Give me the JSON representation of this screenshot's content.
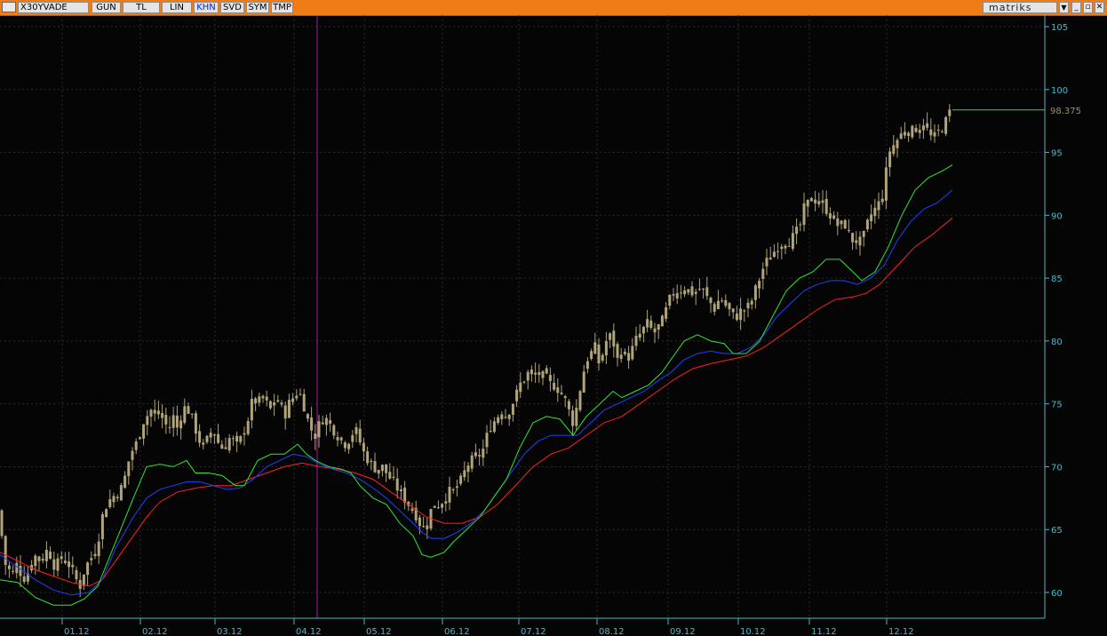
{
  "toolbar": {
    "symbol": "X30YVADE",
    "buttons": [
      "GUN",
      "TL",
      "LIN",
      "KHN",
      "SVD",
      "SYM",
      "TMP"
    ],
    "active_button": "KHN",
    "brand": "matriks",
    "window_controls": [
      "minimize-icon",
      "restore-icon",
      "close-icon"
    ]
  },
  "colors": {
    "background": "#050505",
    "toolbar": "#f07c18",
    "axis_text": "#4cb8c8",
    "candle": "#b0a478",
    "ma_fast": "#2ee82e",
    "ma_mid": "#2040ff",
    "ma_slow": "#ff2020",
    "crosshair": "#a020a0",
    "last_price_line": "#40d040"
  },
  "chart_data": {
    "type": "candlestick",
    "x_ticks": [
      "01.12",
      "02.12",
      "03.12",
      "04.12",
      "05.12",
      "06.12",
      "07.12",
      "08.12",
      "09.12",
      "10.12",
      "11.12",
      "12.12"
    ],
    "y_ticks": [
      60,
      65,
      70,
      75,
      80,
      85,
      90,
      95,
      100,
      105
    ],
    "ylim": [
      57.5,
      106.5
    ],
    "last_price": "98.375",
    "close_points": [
      [
        0,
        66.5
      ],
      [
        4,
        62.5
      ],
      [
        10,
        61.8
      ],
      [
        16,
        61.5
      ],
      [
        20,
        62.5
      ],
      [
        25,
        61.0
      ],
      [
        31,
        61.5
      ],
      [
        38,
        63.0
      ],
      [
        46,
        62.5
      ],
      [
        54,
        63.5
      ],
      [
        62,
        62.0
      ],
      [
        70,
        62.8
      ],
      [
        78,
        62.2
      ],
      [
        86,
        61.0
      ],
      [
        90,
        60.5
      ],
      [
        95,
        61.8
      ],
      [
        100,
        62.5
      ],
      [
        105,
        63.0
      ],
      [
        110,
        64.0
      ],
      [
        115,
        66.0
      ],
      [
        120,
        67.0
      ],
      [
        125,
        67.5
      ],
      [
        130,
        67.8
      ],
      [
        135,
        68.0
      ],
      [
        140,
        69.0
      ],
      [
        145,
        70.5
      ],
      [
        150,
        71.5
      ],
      [
        155,
        72.0
      ],
      [
        160,
        73.5
      ],
      [
        165,
        74.0
      ],
      [
        170,
        74.5
      ],
      [
        175,
        74.0
      ],
      [
        180,
        74.3
      ],
      [
        185,
        73.5
      ],
      [
        190,
        73.0
      ],
      [
        195,
        74.0
      ],
      [
        200,
        73.0
      ],
      [
        205,
        74.5
      ],
      [
        210,
        74.8
      ],
      [
        215,
        74.0
      ],
      [
        220,
        73.0
      ],
      [
        225,
        72.0
      ],
      [
        230,
        71.5
      ],
      [
        235,
        72.5
      ],
      [
        240,
        73.0
      ],
      [
        245,
        72.0
      ],
      [
        250,
        71.5
      ],
      [
        255,
        71.8
      ],
      [
        260,
        72.5
      ],
      [
        265,
        71.5
      ],
      [
        270,
        72.0
      ],
      [
        275,
        73.0
      ],
      [
        280,
        74.0
      ],
      [
        285,
        75.5
      ],
      [
        290,
        75.0
      ],
      [
        295,
        75.5
      ],
      [
        300,
        75.0
      ],
      [
        305,
        74.5
      ],
      [
        310,
        75.5
      ],
      [
        315,
        75.0
      ],
      [
        320,
        74.0
      ],
      [
        325,
        75.0
      ],
      [
        330,
        75.5
      ],
      [
        335,
        76.0
      ],
      [
        340,
        75.5
      ],
      [
        345,
        74.0
      ],
      [
        350,
        73.0
      ],
      [
        355,
        72.5
      ],
      [
        360,
        73.5
      ],
      [
        365,
        74.0
      ],
      [
        370,
        73.5
      ],
      [
        375,
        73.0
      ],
      [
        380,
        72.5
      ],
      [
        385,
        72.0
      ],
      [
        390,
        71.8
      ],
      [
        395,
        72.5
      ],
      [
        400,
        73.0
      ],
      [
        405,
        72.0
      ],
      [
        410,
        71.0
      ],
      [
        415,
        70.5
      ],
      [
        420,
        70.0
      ],
      [
        425,
        69.8
      ],
      [
        430,
        70.0
      ],
      [
        435,
        69.5
      ],
      [
        440,
        69.0
      ],
      [
        445,
        68.5
      ],
      [
        450,
        68.0
      ],
      [
        455,
        67.5
      ],
      [
        460,
        67.0
      ],
      [
        465,
        66.5
      ],
      [
        470,
        66.0
      ],
      [
        475,
        65.0
      ],
      [
        480,
        65.5
      ],
      [
        485,
        66.5
      ],
      [
        490,
        67.0
      ],
      [
        495,
        67.0
      ],
      [
        500,
        67.5
      ],
      [
        505,
        68.0
      ],
      [
        510,
        68.0
      ],
      [
        515,
        68.5
      ],
      [
        520,
        69.0
      ],
      [
        525,
        70.0
      ],
      [
        530,
        70.5
      ],
      [
        535,
        70.5
      ],
      [
        540,
        71.0
      ],
      [
        545,
        71.5
      ],
      [
        550,
        73.0
      ],
      [
        555,
        73.5
      ],
      [
        560,
        74.0
      ],
      [
        565,
        74.5
      ],
      [
        570,
        74.0
      ],
      [
        575,
        74.8
      ],
      [
        580,
        75.5
      ],
      [
        585,
        76.5
      ],
      [
        590,
        77.0
      ],
      [
        595,
        77.5
      ],
      [
        600,
        77.0
      ],
      [
        605,
        77.5
      ],
      [
        610,
        77.2
      ],
      [
        615,
        77.0
      ],
      [
        620,
        76.5
      ],
      [
        625,
        76.5
      ],
      [
        630,
        76.0
      ],
      [
        635,
        75.5
      ],
      [
        640,
        74.5
      ],
      [
        645,
        73.5
      ],
      [
        650,
        75.0
      ],
      [
        655,
        77.0
      ],
      [
        660,
        78.5
      ],
      [
        665,
        79.0
      ],
      [
        670,
        79.5
      ],
      [
        675,
        78.0
      ],
      [
        680,
        79.5
      ],
      [
        685,
        80.5
      ],
      [
        690,
        80.0
      ],
      [
        695,
        78.5
      ],
      [
        700,
        79.5
      ],
      [
        705,
        78.5
      ],
      [
        710,
        79.0
      ],
      [
        715,
        80.0
      ],
      [
        720,
        80.5
      ],
      [
        725,
        81.0
      ],
      [
        730,
        81.5
      ],
      [
        735,
        80.5
      ],
      [
        740,
        81.0
      ],
      [
        745,
        81.5
      ],
      [
        750,
        82.5
      ],
      [
        755,
        83.5
      ],
      [
        760,
        84.0
      ],
      [
        765,
        84.0
      ],
      [
        770,
        84.3
      ],
      [
        775,
        84.0
      ],
      [
        780,
        83.8
      ],
      [
        785,
        84.0
      ],
      [
        790,
        84.2
      ],
      [
        795,
        83.5
      ],
      [
        800,
        83.0
      ],
      [
        805,
        82.5
      ],
      [
        810,
        83.5
      ],
      [
        815,
        83.0
      ],
      [
        820,
        82.5
      ],
      [
        825,
        82.0
      ],
      [
        830,
        82.0
      ],
      [
        835,
        82.5
      ],
      [
        840,
        82.5
      ],
      [
        845,
        83.0
      ],
      [
        850,
        84.0
      ],
      [
        855,
        85.0
      ],
      [
        860,
        86.0
      ],
      [
        865,
        86.5
      ],
      [
        870,
        87.0
      ],
      [
        875,
        87.5
      ],
      [
        880,
        87.8
      ],
      [
        885,
        88.0
      ],
      [
        890,
        88.0
      ],
      [
        895,
        88.5
      ],
      [
        900,
        89.0
      ],
      [
        905,
        90.5
      ],
      [
        910,
        91.0
      ],
      [
        915,
        91.5
      ],
      [
        920,
        91.0
      ],
      [
        925,
        91.0
      ],
      [
        930,
        90.5
      ],
      [
        935,
        90.0
      ],
      [
        940,
        89.5
      ],
      [
        945,
        89.0
      ],
      [
        950,
        89.5
      ],
      [
        955,
        88.5
      ],
      [
        960,
        88.0
      ],
      [
        965,
        88.0
      ],
      [
        970,
        87.8
      ],
      [
        975,
        89.0
      ],
      [
        980,
        90.0
      ],
      [
        985,
        90.5
      ],
      [
        990,
        91.0
      ],
      [
        995,
        92.0
      ],
      [
        1000,
        95.0
      ],
      [
        1005,
        95.5
      ],
      [
        1010,
        96.0
      ],
      [
        1015,
        96.5
      ],
      [
        1020,
        97.0
      ],
      [
        1025,
        96.5
      ],
      [
        1030,
        97.0
      ],
      [
        1035,
        96.8
      ],
      [
        1040,
        97.5
      ],
      [
        1045,
        96.5
      ],
      [
        1050,
        96.0
      ],
      [
        1055,
        96.5
      ],
      [
        1060,
        97.0
      ],
      [
        1065,
        97.5
      ],
      [
        1070,
        98.375
      ]
    ],
    "ma_fast": [
      [
        0,
        61.0
      ],
      [
        20,
        60.8
      ],
      [
        40,
        59.6
      ],
      [
        60,
        59.0
      ],
      [
        80,
        59.0
      ],
      [
        95,
        59.5
      ],
      [
        110,
        60.5
      ],
      [
        130,
        64.0
      ],
      [
        150,
        67.5
      ],
      [
        165,
        70.0
      ],
      [
        180,
        70.2
      ],
      [
        195,
        70.0
      ],
      [
        210,
        70.5
      ],
      [
        220,
        69.5
      ],
      [
        235,
        69.5
      ],
      [
        250,
        69.3
      ],
      [
        265,
        68.5
      ],
      [
        275,
        68.5
      ],
      [
        290,
        70.5
      ],
      [
        305,
        71.0
      ],
      [
        320,
        71.0
      ],
      [
        335,
        71.8
      ],
      [
        345,
        71.0
      ],
      [
        355,
        70.5
      ],
      [
        370,
        70.0
      ],
      [
        385,
        69.8
      ],
      [
        395,
        69.5
      ],
      [
        405,
        68.5
      ],
      [
        420,
        67.5
      ],
      [
        435,
        67.0
      ],
      [
        450,
        65.5
      ],
      [
        465,
        64.5
      ],
      [
        475,
        63.0
      ],
      [
        485,
        62.8
      ],
      [
        500,
        63.2
      ],
      [
        510,
        64.0
      ],
      [
        525,
        65.0
      ],
      [
        540,
        66.0
      ],
      [
        555,
        67.5
      ],
      [
        570,
        69.0
      ],
      [
        585,
        71.5
      ],
      [
        600,
        73.5
      ],
      [
        615,
        74.0
      ],
      [
        630,
        73.8
      ],
      [
        645,
        72.5
      ],
      [
        660,
        74.0
      ],
      [
        675,
        75.0
      ],
      [
        690,
        76.0
      ],
      [
        700,
        75.5
      ],
      [
        715,
        76.0
      ],
      [
        730,
        76.5
      ],
      [
        745,
        77.5
      ],
      [
        760,
        79.0
      ],
      [
        770,
        80.0
      ],
      [
        785,
        80.5
      ],
      [
        800,
        80.0
      ],
      [
        815,
        79.8
      ],
      [
        825,
        79.0
      ],
      [
        840,
        79.0
      ],
      [
        855,
        80.0
      ],
      [
        870,
        82.0
      ],
      [
        885,
        84.0
      ],
      [
        900,
        85.0
      ],
      [
        915,
        85.5
      ],
      [
        930,
        86.5
      ],
      [
        945,
        86.5
      ],
      [
        960,
        85.5
      ],
      [
        970,
        84.8
      ],
      [
        985,
        85.5
      ],
      [
        1000,
        87.5
      ],
      [
        1015,
        90.0
      ],
      [
        1030,
        92.0
      ],
      [
        1045,
        93.0
      ],
      [
        1060,
        93.5
      ],
      [
        1072,
        94.0
      ]
    ],
    "ma_mid": [
      [
        0,
        63.0
      ],
      [
        20,
        62.0
      ],
      [
        40,
        61.0
      ],
      [
        60,
        60.2
      ],
      [
        80,
        59.8
      ],
      [
        100,
        60.0
      ],
      [
        115,
        61.0
      ],
      [
        130,
        63.5
      ],
      [
        150,
        66.0
      ],
      [
        165,
        67.5
      ],
      [
        180,
        68.2
      ],
      [
        195,
        68.5
      ],
      [
        210,
        68.8
      ],
      [
        225,
        68.8
      ],
      [
        240,
        68.5
      ],
      [
        255,
        68.2
      ],
      [
        270,
        68.3
      ],
      [
        285,
        69.0
      ],
      [
        300,
        70.0
      ],
      [
        315,
        70.5
      ],
      [
        330,
        71.0
      ],
      [
        345,
        70.8
      ],
      [
        360,
        70.2
      ],
      [
        375,
        69.8
      ],
      [
        390,
        69.5
      ],
      [
        405,
        69.0
      ],
      [
        420,
        68.3
      ],
      [
        435,
        67.5
      ],
      [
        450,
        66.5
      ],
      [
        465,
        65.5
      ],
      [
        475,
        64.8
      ],
      [
        485,
        64.3
      ],
      [
        500,
        64.3
      ],
      [
        515,
        64.8
      ],
      [
        530,
        65.5
      ],
      [
        545,
        66.5
      ],
      [
        560,
        68.0
      ],
      [
        575,
        69.5
      ],
      [
        590,
        71.0
      ],
      [
        605,
        72.0
      ],
      [
        620,
        72.5
      ],
      [
        635,
        72.5
      ],
      [
        650,
        72.5
      ],
      [
        665,
        73.5
      ],
      [
        680,
        74.5
      ],
      [
        695,
        75.0
      ],
      [
        710,
        75.5
      ],
      [
        725,
        76.0
      ],
      [
        740,
        76.8
      ],
      [
        755,
        77.5
      ],
      [
        770,
        78.5
      ],
      [
        785,
        79.0
      ],
      [
        800,
        79.2
      ],
      [
        815,
        79.0
      ],
      [
        830,
        79.0
      ],
      [
        845,
        79.5
      ],
      [
        860,
        80.5
      ],
      [
        875,
        82.0
      ],
      [
        890,
        83.0
      ],
      [
        905,
        84.0
      ],
      [
        920,
        84.5
      ],
      [
        935,
        84.8
      ],
      [
        950,
        84.8
      ],
      [
        965,
        84.5
      ],
      [
        980,
        85.0
      ],
      [
        995,
        86.0
      ],
      [
        1010,
        88.0
      ],
      [
        1025,
        89.5
      ],
      [
        1040,
        90.5
      ],
      [
        1055,
        91.0
      ],
      [
        1072,
        92.0
      ]
    ],
    "ma_slow": [
      [
        0,
        63.2
      ],
      [
        20,
        62.5
      ],
      [
        40,
        61.8
      ],
      [
        60,
        61.3
      ],
      [
        80,
        60.8
      ],
      [
        100,
        60.5
      ],
      [
        115,
        61.0
      ],
      [
        130,
        62.5
      ],
      [
        150,
        64.5
      ],
      [
        165,
        66.0
      ],
      [
        180,
        67.2
      ],
      [
        200,
        68.0
      ],
      [
        220,
        68.3
      ],
      [
        240,
        68.5
      ],
      [
        260,
        68.5
      ],
      [
        280,
        69.0
      ],
      [
        300,
        69.5
      ],
      [
        320,
        70.0
      ],
      [
        340,
        70.3
      ],
      [
        360,
        70.0
      ],
      [
        380,
        69.8
      ],
      [
        400,
        69.5
      ],
      [
        420,
        69.0
      ],
      [
        440,
        68.0
      ],
      [
        460,
        67.0
      ],
      [
        480,
        66.0
      ],
      [
        500,
        65.5
      ],
      [
        520,
        65.5
      ],
      [
        540,
        66.0
      ],
      [
        560,
        67.0
      ],
      [
        580,
        68.5
      ],
      [
        600,
        70.0
      ],
      [
        620,
        71.0
      ],
      [
        640,
        71.5
      ],
      [
        660,
        72.5
      ],
      [
        680,
        73.5
      ],
      [
        700,
        74.0
      ],
      [
        720,
        75.0
      ],
      [
        740,
        76.0
      ],
      [
        760,
        77.0
      ],
      [
        780,
        77.8
      ],
      [
        800,
        78.2
      ],
      [
        820,
        78.5
      ],
      [
        840,
        78.8
      ],
      [
        860,
        79.5
      ],
      [
        880,
        80.5
      ],
      [
        900,
        81.5
      ],
      [
        920,
        82.5
      ],
      [
        940,
        83.3
      ],
      [
        960,
        83.5
      ],
      [
        975,
        83.8
      ],
      [
        990,
        84.5
      ],
      [
        1010,
        86.0
      ],
      [
        1030,
        87.5
      ],
      [
        1050,
        88.5
      ],
      [
        1072,
        89.8
      ]
    ]
  }
}
